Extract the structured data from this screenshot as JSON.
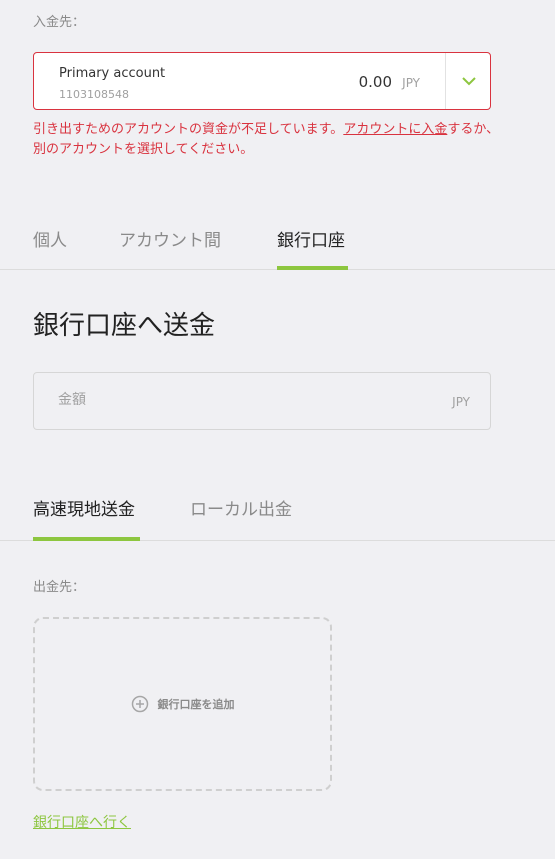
{
  "deposit_to": {
    "label": "入金先："
  },
  "account": {
    "name": "Primary account",
    "number": "1103108548",
    "balance": "0.00",
    "currency": "JPY"
  },
  "error": {
    "part1": "引き出すためのアカウントの資金が不足しています。",
    "link": "アカウントに入金",
    "part2": "するか、別のアカウントを選択してください。"
  },
  "transfer_tabs": [
    {
      "label": "個人",
      "active": false
    },
    {
      "label": "アカウント間",
      "active": false
    },
    {
      "label": "銀行口座",
      "active": true
    }
  ],
  "section_title": "銀行口座へ送金",
  "amount": {
    "placeholder": "金額",
    "value": "",
    "currency": "JPY"
  },
  "method_tabs": [
    {
      "label": "高速現地送金",
      "active": true
    },
    {
      "label": "ローカル出金",
      "active": false
    }
  ],
  "withdraw_to": {
    "label": "出金先："
  },
  "add_bank": {
    "label": "銀行口座を追加",
    "icon": "plus-circle-icon"
  },
  "goto_bank_link": "銀行口座へ行く",
  "colors": {
    "accent": "#8dc63f",
    "error": "#d9333f",
    "background": "#f0f0f3"
  }
}
